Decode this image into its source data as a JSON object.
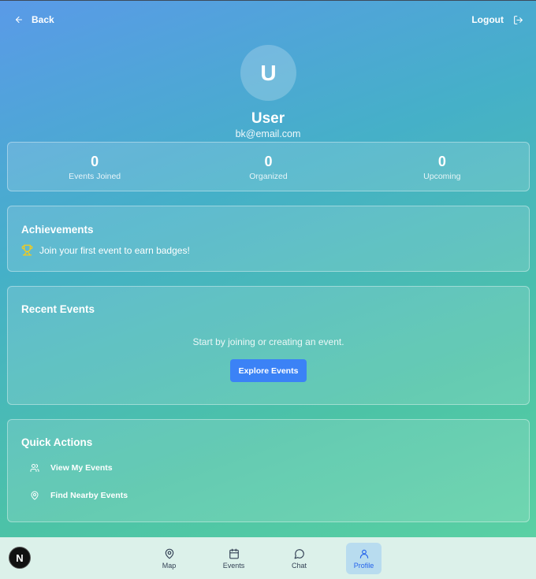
{
  "header": {
    "back_label": "Back",
    "logout_label": "Logout"
  },
  "profile": {
    "avatar_initial": "U",
    "name": "User",
    "email": "bk@email.com"
  },
  "stats": [
    {
      "value": "0",
      "label": "Events Joined"
    },
    {
      "value": "0",
      "label": "Organized"
    },
    {
      "value": "0",
      "label": "Upcoming"
    }
  ],
  "achievements": {
    "title": "Achievements",
    "message": "Join your first event to earn badges!",
    "icon": "trophy-icon"
  },
  "recent_events": {
    "title": "Recent Events",
    "empty_message": "Start by joining or creating an event.",
    "button_label": "Explore Events"
  },
  "quick_actions": {
    "title": "Quick Actions",
    "items": [
      {
        "label": "View My Events",
        "icon": "users-icon"
      },
      {
        "label": "Find Nearby Events",
        "icon": "map-pin-icon"
      }
    ]
  },
  "bottom_nav": {
    "items": [
      {
        "label": "Map",
        "icon": "map-pin-icon"
      },
      {
        "label": "Events",
        "icon": "calendar-icon"
      },
      {
        "label": "Chat",
        "icon": "chat-icon"
      },
      {
        "label": "Profile",
        "icon": "user-icon",
        "active": true
      }
    ]
  },
  "dev_badge": {
    "letter": "N"
  },
  "colors": {
    "accent": "#3b82f6",
    "active_nav_bg": "#b8dcef",
    "active_nav_text": "#2563eb",
    "nav_bg": "#dcf1ea",
    "trophy": "#facc15"
  }
}
